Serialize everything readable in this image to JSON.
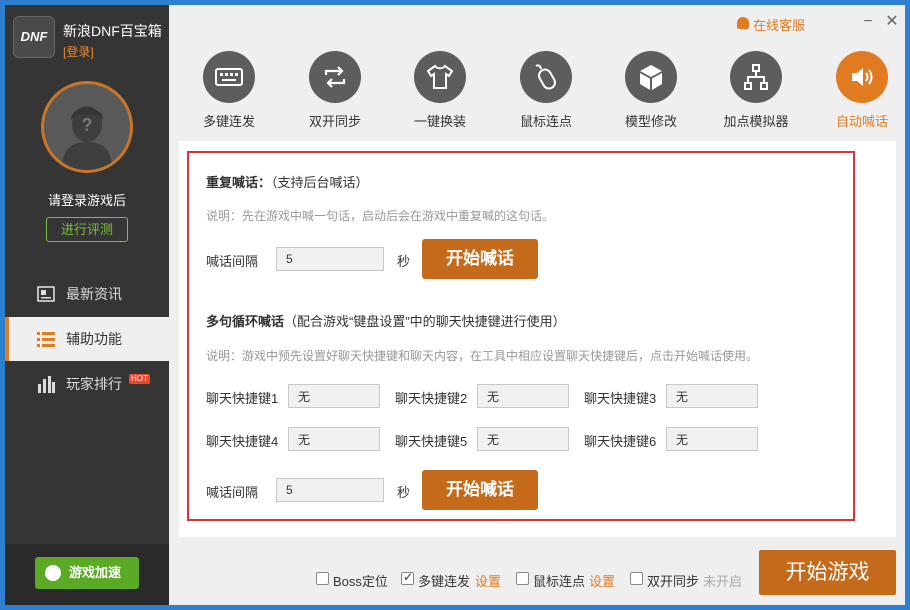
{
  "app": {
    "name": "新浪DNF百宝箱",
    "login_link": "[登录]",
    "logo_text": "DNF"
  },
  "profile": {
    "login_prompt": "请登录游戏后",
    "eval_button": "进行评测"
  },
  "nav": [
    {
      "label": "最新资讯",
      "icon": "news-icon"
    },
    {
      "label": "辅助功能",
      "icon": "list-icon",
      "active": true
    },
    {
      "label": "玩家排行",
      "icon": "bar-chart-icon",
      "badge": "HOT"
    }
  ],
  "accelerate_button": "游戏加速",
  "titlebar": {
    "service": "在线客服",
    "minimize": "−",
    "close": "✕"
  },
  "tools": [
    {
      "label": "多键连发",
      "icon": "keyboard-icon"
    },
    {
      "label": "双开同步",
      "icon": "sync-icon"
    },
    {
      "label": "一键换装",
      "icon": "shirt-icon"
    },
    {
      "label": "鼠标连点",
      "icon": "mouse-icon"
    },
    {
      "label": "模型修改",
      "icon": "cube-icon"
    },
    {
      "label": "加点模拟器",
      "icon": "tree-icon"
    },
    {
      "label": "自动喊话",
      "icon": "speaker-icon",
      "active": true
    }
  ],
  "repeat": {
    "title": "重复喊话：",
    "title_note": "（支持后台喊话）",
    "desc": "说明：先在游戏中喊一句话，启动后会在游戏中重复喊的这句话。",
    "interval_label": "喊话间隔",
    "interval_value": "5",
    "unit": "秒",
    "start_button": "开始喊话"
  },
  "cycle": {
    "title": "多句循环喊话",
    "title_note": "（配合游戏“键盘设置”中的聊天快捷键进行使用）",
    "desc": "说明：游戏中预先设置好聊天快捷键和聊天内容，在工具中相应设置聊天快捷键后，点击开始喊话使用。",
    "hotkeys": [
      {
        "label": "聊天快捷键1",
        "value": "无"
      },
      {
        "label": "聊天快捷键2",
        "value": "无"
      },
      {
        "label": "聊天快捷键3",
        "value": "无"
      },
      {
        "label": "聊天快捷键4",
        "value": "无"
      },
      {
        "label": "聊天快捷键5",
        "value": "无"
      },
      {
        "label": "聊天快捷键6",
        "value": "无"
      }
    ],
    "interval_label": "喊话间隔",
    "interval_value": "5",
    "unit": "秒",
    "start_button": "开始喊话"
  },
  "bottom": {
    "boss": {
      "label": "Boss定位",
      "checked": false
    },
    "multikey": {
      "label": "多键连发",
      "checked": true,
      "link": "设置"
    },
    "mouse": {
      "label": "鼠标连点",
      "checked": false,
      "link": "设置"
    },
    "dual": {
      "label": "双开同步",
      "checked": false,
      "status": "未开启"
    },
    "start_game": "开始游戏"
  },
  "colors": {
    "accent": "#e07b22",
    "button": "#c46a1a",
    "sidebar": "#353535",
    "green": "#5aaa26",
    "frame": "#d9333d"
  }
}
